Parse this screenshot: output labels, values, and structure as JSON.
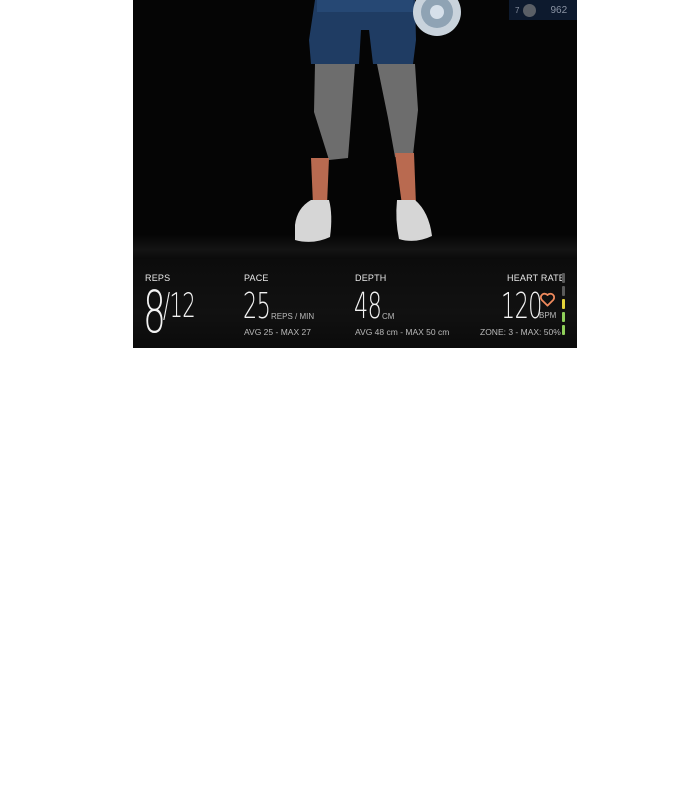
{
  "leaderboard": {
    "rank": "7",
    "score": "962"
  },
  "metrics": {
    "reps": {
      "label": "REPS",
      "current": "8",
      "total": "/12"
    },
    "pace": {
      "label": "PACE",
      "value": "25",
      "unit": "REPS / MIN",
      "stats": "AVG 25  - MAX 27"
    },
    "depth": {
      "label": "DEPTH",
      "value": "48",
      "unit": "CM",
      "stats": "AVG 48 cm - MAX 50 cm"
    },
    "heart_rate": {
      "label": "HEART RATE",
      "value": "120",
      "unit": "BPM",
      "stats": "ZONE: 3 - MAX: 50%"
    }
  },
  "colors": {
    "heart": "#f08a5d",
    "zones": [
      "#5a5a5a",
      "#5a5a5a",
      "#e5d43a",
      "#8fcf5a",
      "#8fcf5a"
    ]
  },
  "icons": {
    "heart": "heart-outline-icon"
  }
}
